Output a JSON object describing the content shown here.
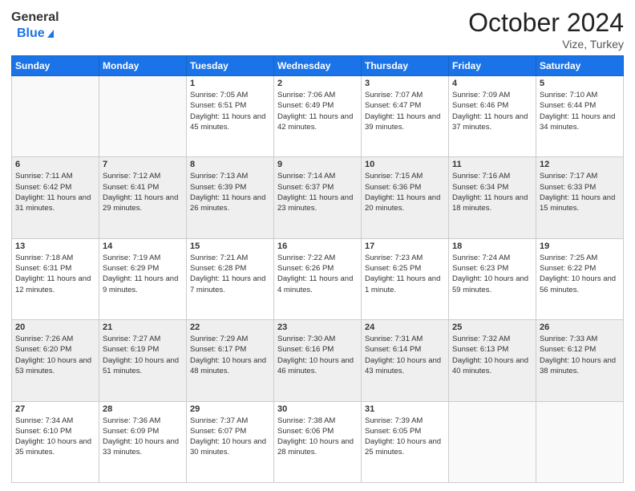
{
  "header": {
    "logo_line1": "General",
    "logo_line2": "Blue",
    "month": "October 2024",
    "location": "Vize, Turkey"
  },
  "weekdays": [
    "Sunday",
    "Monday",
    "Tuesday",
    "Wednesday",
    "Thursday",
    "Friday",
    "Saturday"
  ],
  "weeks": [
    [
      {
        "day": "",
        "text": ""
      },
      {
        "day": "",
        "text": ""
      },
      {
        "day": "1",
        "text": "Sunrise: 7:05 AM\nSunset: 6:51 PM\nDaylight: 11 hours and 45 minutes."
      },
      {
        "day": "2",
        "text": "Sunrise: 7:06 AM\nSunset: 6:49 PM\nDaylight: 11 hours and 42 minutes."
      },
      {
        "day": "3",
        "text": "Sunrise: 7:07 AM\nSunset: 6:47 PM\nDaylight: 11 hours and 39 minutes."
      },
      {
        "day": "4",
        "text": "Sunrise: 7:09 AM\nSunset: 6:46 PM\nDaylight: 11 hours and 37 minutes."
      },
      {
        "day": "5",
        "text": "Sunrise: 7:10 AM\nSunset: 6:44 PM\nDaylight: 11 hours and 34 minutes."
      }
    ],
    [
      {
        "day": "6",
        "text": "Sunrise: 7:11 AM\nSunset: 6:42 PM\nDaylight: 11 hours and 31 minutes."
      },
      {
        "day": "7",
        "text": "Sunrise: 7:12 AM\nSunset: 6:41 PM\nDaylight: 11 hours and 29 minutes."
      },
      {
        "day": "8",
        "text": "Sunrise: 7:13 AM\nSunset: 6:39 PM\nDaylight: 11 hours and 26 minutes."
      },
      {
        "day": "9",
        "text": "Sunrise: 7:14 AM\nSunset: 6:37 PM\nDaylight: 11 hours and 23 minutes."
      },
      {
        "day": "10",
        "text": "Sunrise: 7:15 AM\nSunset: 6:36 PM\nDaylight: 11 hours and 20 minutes."
      },
      {
        "day": "11",
        "text": "Sunrise: 7:16 AM\nSunset: 6:34 PM\nDaylight: 11 hours and 18 minutes."
      },
      {
        "day": "12",
        "text": "Sunrise: 7:17 AM\nSunset: 6:33 PM\nDaylight: 11 hours and 15 minutes."
      }
    ],
    [
      {
        "day": "13",
        "text": "Sunrise: 7:18 AM\nSunset: 6:31 PM\nDaylight: 11 hours and 12 minutes."
      },
      {
        "day": "14",
        "text": "Sunrise: 7:19 AM\nSunset: 6:29 PM\nDaylight: 11 hours and 9 minutes."
      },
      {
        "day": "15",
        "text": "Sunrise: 7:21 AM\nSunset: 6:28 PM\nDaylight: 11 hours and 7 minutes."
      },
      {
        "day": "16",
        "text": "Sunrise: 7:22 AM\nSunset: 6:26 PM\nDaylight: 11 hours and 4 minutes."
      },
      {
        "day": "17",
        "text": "Sunrise: 7:23 AM\nSunset: 6:25 PM\nDaylight: 11 hours and 1 minute."
      },
      {
        "day": "18",
        "text": "Sunrise: 7:24 AM\nSunset: 6:23 PM\nDaylight: 10 hours and 59 minutes."
      },
      {
        "day": "19",
        "text": "Sunrise: 7:25 AM\nSunset: 6:22 PM\nDaylight: 10 hours and 56 minutes."
      }
    ],
    [
      {
        "day": "20",
        "text": "Sunrise: 7:26 AM\nSunset: 6:20 PM\nDaylight: 10 hours and 53 minutes."
      },
      {
        "day": "21",
        "text": "Sunrise: 7:27 AM\nSunset: 6:19 PM\nDaylight: 10 hours and 51 minutes."
      },
      {
        "day": "22",
        "text": "Sunrise: 7:29 AM\nSunset: 6:17 PM\nDaylight: 10 hours and 48 minutes."
      },
      {
        "day": "23",
        "text": "Sunrise: 7:30 AM\nSunset: 6:16 PM\nDaylight: 10 hours and 46 minutes."
      },
      {
        "day": "24",
        "text": "Sunrise: 7:31 AM\nSunset: 6:14 PM\nDaylight: 10 hours and 43 minutes."
      },
      {
        "day": "25",
        "text": "Sunrise: 7:32 AM\nSunset: 6:13 PM\nDaylight: 10 hours and 40 minutes."
      },
      {
        "day": "26",
        "text": "Sunrise: 7:33 AM\nSunset: 6:12 PM\nDaylight: 10 hours and 38 minutes."
      }
    ],
    [
      {
        "day": "27",
        "text": "Sunrise: 7:34 AM\nSunset: 6:10 PM\nDaylight: 10 hours and 35 minutes."
      },
      {
        "day": "28",
        "text": "Sunrise: 7:36 AM\nSunset: 6:09 PM\nDaylight: 10 hours and 33 minutes."
      },
      {
        "day": "29",
        "text": "Sunrise: 7:37 AM\nSunset: 6:07 PM\nDaylight: 10 hours and 30 minutes."
      },
      {
        "day": "30",
        "text": "Sunrise: 7:38 AM\nSunset: 6:06 PM\nDaylight: 10 hours and 28 minutes."
      },
      {
        "day": "31",
        "text": "Sunrise: 7:39 AM\nSunset: 6:05 PM\nDaylight: 10 hours and 25 minutes."
      },
      {
        "day": "",
        "text": ""
      },
      {
        "day": "",
        "text": ""
      }
    ]
  ]
}
